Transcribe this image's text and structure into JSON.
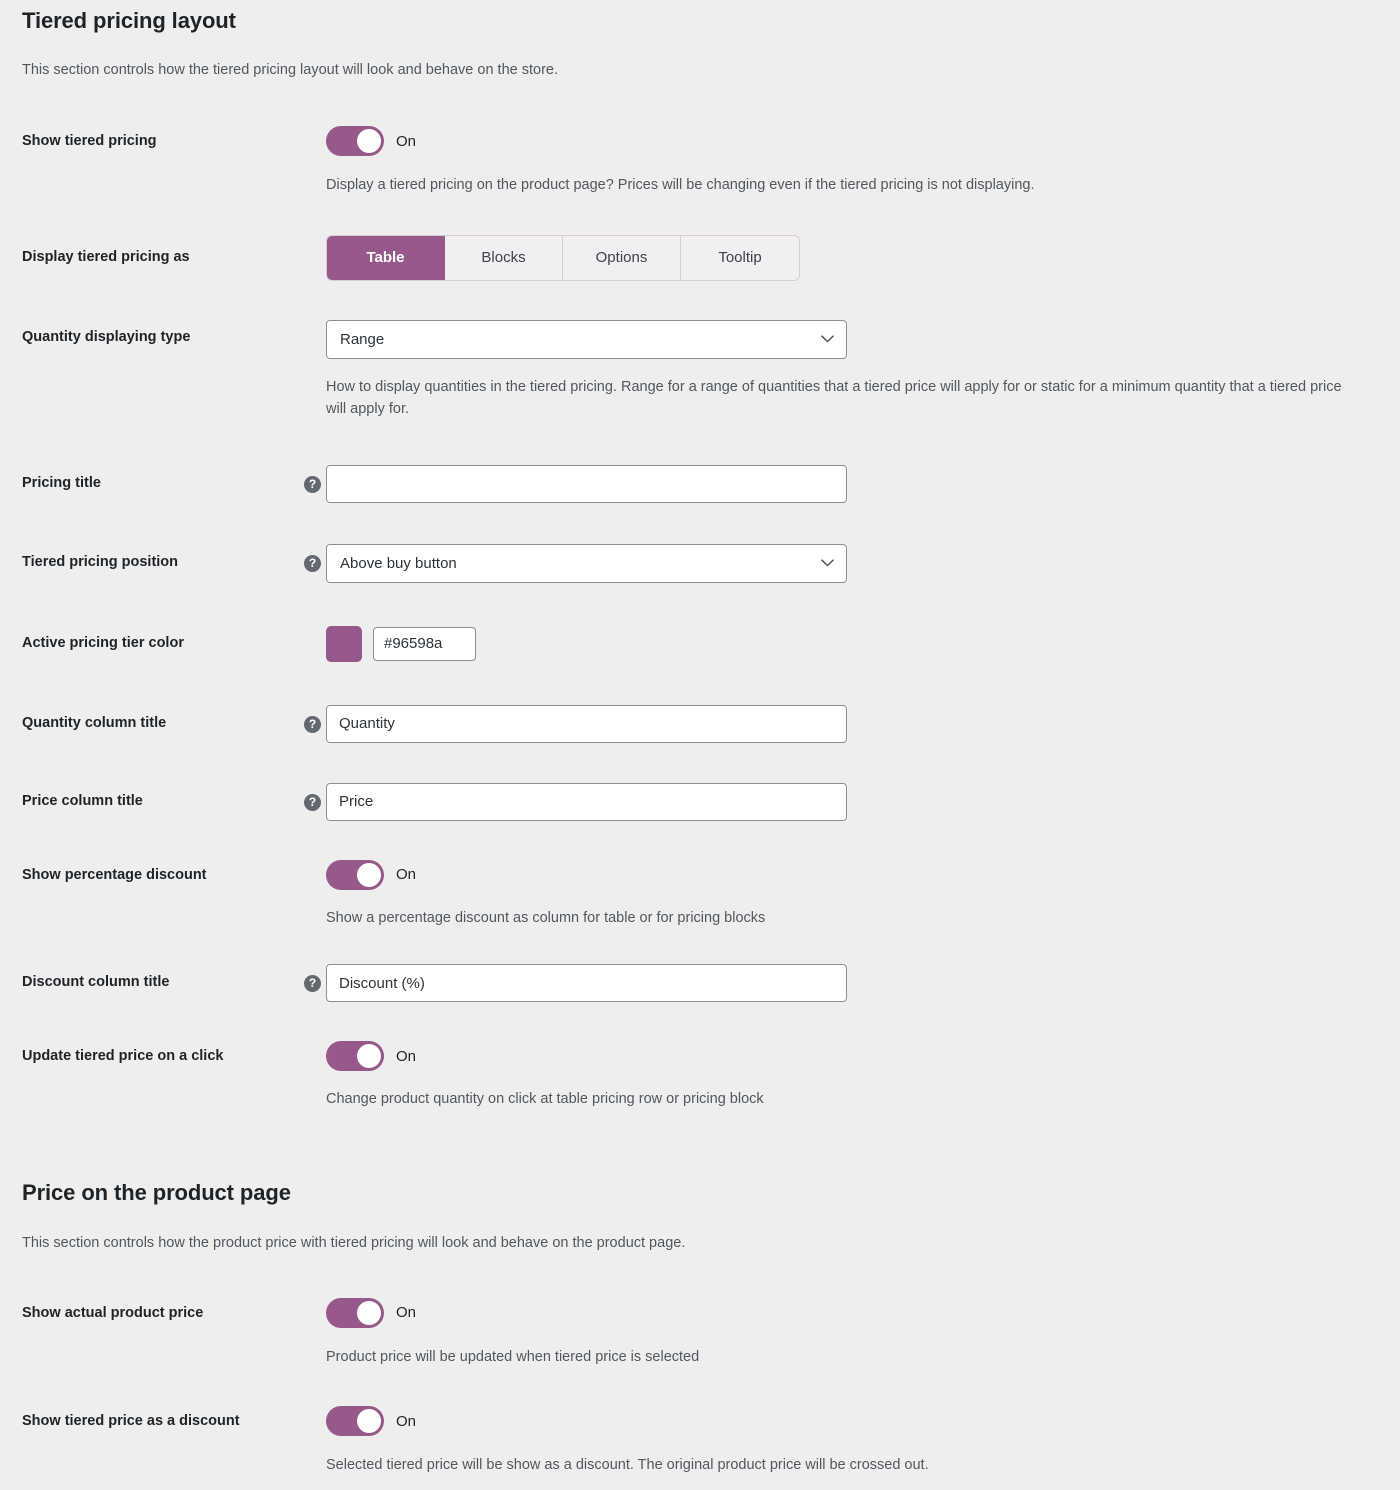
{
  "sections": [
    {
      "id": "tiered-pricing-layout",
      "title": "Tiered pricing layout",
      "description": "This section controls how the tiered pricing layout will look and behave on the store."
    },
    {
      "id": "price-on-product-page",
      "title": "Price on the product page",
      "description": "This section controls how the product price with tiered pricing will look and behave on the product page."
    }
  ],
  "fields": {
    "show_tiered_pricing": {
      "label": "Show tiered pricing",
      "toggle_state": "On",
      "description": "Display a tiered pricing on the product page? Prices will be changing even if the tiered pricing is not displaying."
    },
    "display_tiered_pricing_as": {
      "label": "Display tiered pricing as",
      "options": [
        "Table",
        "Blocks",
        "Options",
        "Tooltip"
      ],
      "selected": "Table"
    },
    "quantity_displaying_type": {
      "label": "Quantity displaying type",
      "value": "Range",
      "description": "How to display quantities in the tiered pricing. Range for a range of quantities that a tiered price will apply for or static for a minimum quantity that a tiered price will apply for."
    },
    "pricing_title": {
      "label": "Pricing title",
      "value": "",
      "help_icon": "help-icon"
    },
    "tiered_pricing_position": {
      "label": "Tiered pricing position",
      "value": "Above buy button",
      "help_icon": "help-icon"
    },
    "active_pricing_tier_color": {
      "label": "Active pricing tier color",
      "value": "#96598a",
      "swatch_color": "#96598a"
    },
    "quantity_column_title": {
      "label": "Quantity column title",
      "value": "Quantity",
      "help_icon": "help-icon"
    },
    "price_column_title": {
      "label": "Price column title",
      "value": "Price",
      "help_icon": "help-icon"
    },
    "show_percentage_discount": {
      "label": "Show percentage discount",
      "toggle_state": "On",
      "description": "Show a percentage discount as column for table or for pricing blocks"
    },
    "discount_column_title": {
      "label": "Discount column title",
      "value": "Discount (%)",
      "help_icon": "help-icon"
    },
    "update_tiered_price_on_click": {
      "label": "Update tiered price on a click",
      "toggle_state": "On",
      "description": "Change product quantity on click at table pricing row or pricing block"
    },
    "show_actual_product_price": {
      "label": "Show actual product price",
      "toggle_state": "On",
      "description": "Product price will be updated when tiered price is selected"
    },
    "show_tiered_price_as_discount": {
      "label": "Show tiered price as a discount",
      "toggle_state": "On",
      "description": "Selected tiered price will be show as a discount. The original product price will be crossed out."
    }
  },
  "icons": {
    "help": "?",
    "chevron_down": "chevron-down-icon"
  },
  "colors": {
    "accent": "#96598a",
    "page_background": "#eeeeef",
    "label_text": "#1d2327",
    "description_text": "#50575e"
  }
}
